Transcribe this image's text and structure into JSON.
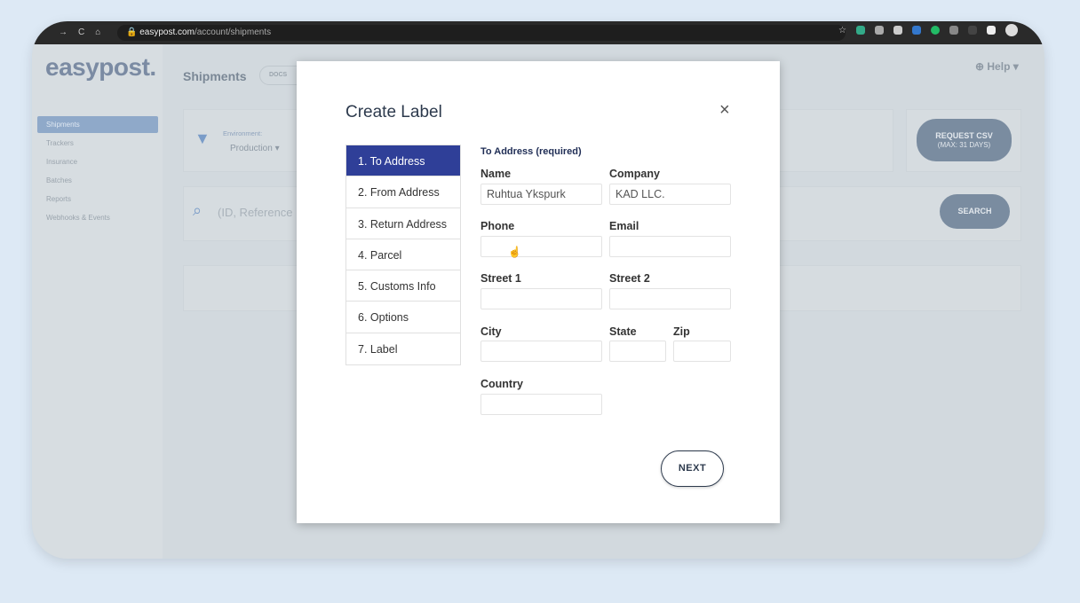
{
  "browser": {
    "url_host": "easypost.com",
    "url_path": "/account/shipments"
  },
  "app": {
    "logo": "easypost.",
    "page_title": "Shipments",
    "docs": "DOCS",
    "help": "Help",
    "sidebar": [
      "Shipments",
      "Trackers",
      "Insurance",
      "Batches",
      "Reports",
      "Webhooks & Events"
    ],
    "environment_label": "Environment:",
    "environment_value": "Production",
    "search_placeholder": "(ID, Reference",
    "request_csv": "REQUEST CSV",
    "request_csv_sub": "(MAX: 31 DAYS)",
    "search_button": "SEARCH"
  },
  "modal": {
    "title": "Create Label",
    "close": "×",
    "steps": [
      "1. To Address",
      "2. From Address",
      "3. Return Address",
      "4. Parcel",
      "5. Customs Info",
      "6. Options",
      "7. Label"
    ],
    "section": "To Address (required)",
    "fields": {
      "name": {
        "label": "Name",
        "value": "Ruhtua Ykspurk"
      },
      "company": {
        "label": "Company",
        "value": "KAD LLC."
      },
      "phone": {
        "label": "Phone",
        "value": ""
      },
      "email": {
        "label": "Email",
        "value": ""
      },
      "street1": {
        "label": "Street 1",
        "value": ""
      },
      "street2": {
        "label": "Street 2",
        "value": ""
      },
      "city": {
        "label": "City",
        "value": ""
      },
      "state": {
        "label": "State",
        "value": ""
      },
      "zip": {
        "label": "Zip",
        "value": ""
      },
      "country": {
        "label": "Country",
        "value": ""
      }
    },
    "next": "NEXT"
  }
}
